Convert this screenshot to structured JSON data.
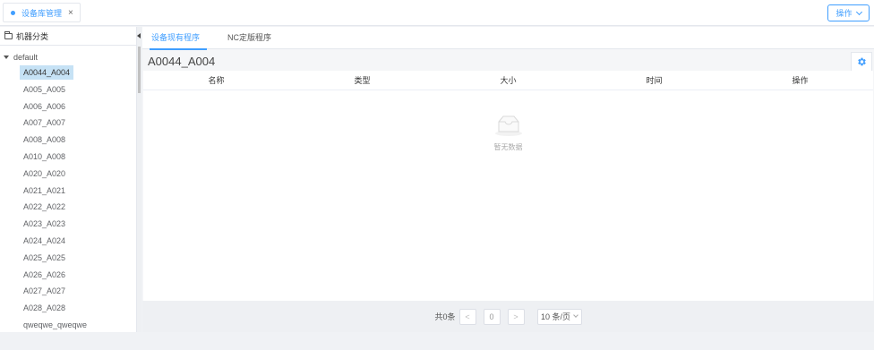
{
  "header": {
    "page_tab_label": "设备库管理",
    "page_tab_close": "×",
    "ops_button": "操作"
  },
  "sidebar": {
    "title": "机器分类",
    "root_label": "default",
    "items": [
      "A0044_A004",
      "A005_A005",
      "A006_A006",
      "A007_A007",
      "A008_A008",
      "A010_A008",
      "A020_A020",
      "A021_A021",
      "A022_A022",
      "A023_A023",
      "A024_A024",
      "A025_A025",
      "A026_A026",
      "A027_A027",
      "A028_A028",
      "qweqwe_qweqwe"
    ],
    "selected_index": 0
  },
  "main": {
    "tabs": [
      {
        "label": "设备现有程序",
        "active": true
      },
      {
        "label": "NC定版程序",
        "active": false
      }
    ],
    "device_title": "A0044_A004",
    "columns": [
      "名称",
      "类型",
      "大小",
      "时间",
      "操作"
    ],
    "empty_text": "暂无数据"
  },
  "pagination": {
    "total_text": "共0条",
    "prev": "<",
    "current_page": "0",
    "next": ">",
    "page_size": "10 条/页"
  },
  "colors": {
    "accent": "#409eff",
    "selected_bg": "#c6e2f5"
  }
}
